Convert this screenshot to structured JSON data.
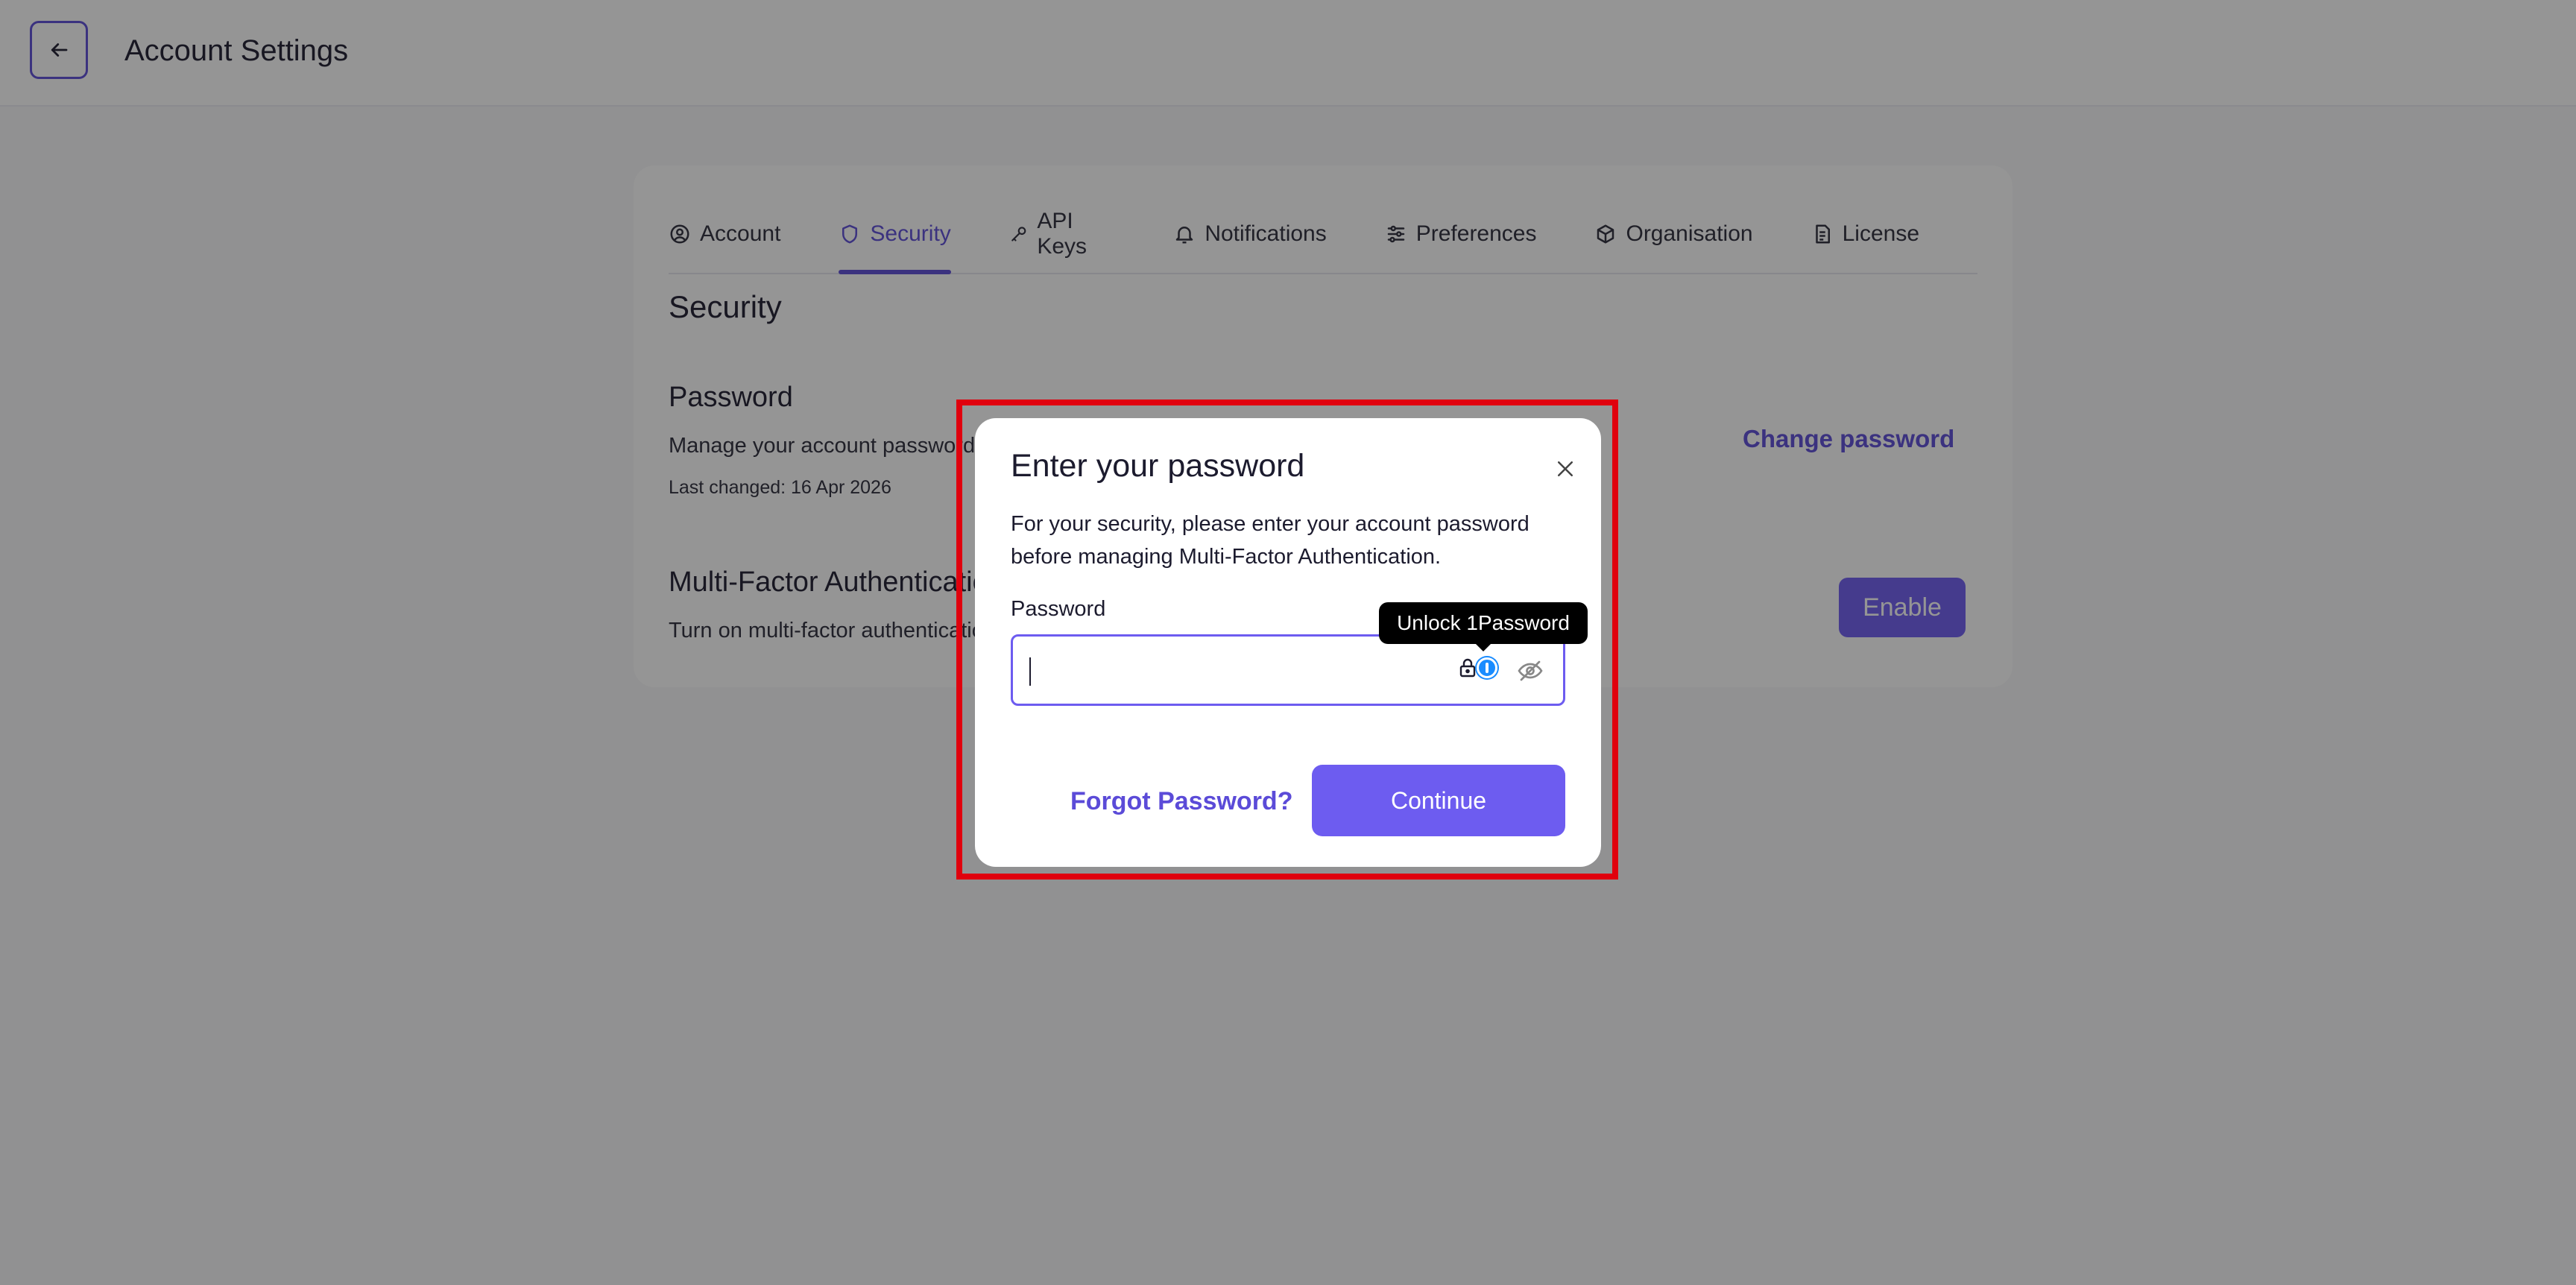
{
  "header": {
    "title": "Account Settings",
    "back_icon": "arrow-left-icon"
  },
  "tabs": [
    {
      "label": "Account",
      "icon": "user-circle-icon",
      "active": false
    },
    {
      "label": "Security",
      "icon": "shield-icon",
      "active": true
    },
    {
      "label": "API Keys",
      "icon": "key-icon",
      "active": false
    },
    {
      "label": "Notifications",
      "icon": "bell-icon",
      "active": false
    },
    {
      "label": "Preferences",
      "icon": "sliders-icon",
      "active": false
    },
    {
      "label": "Organisation",
      "icon": "cube-icon",
      "active": false
    },
    {
      "label": "License",
      "icon": "document-icon",
      "active": false
    }
  ],
  "security": {
    "heading": "Security",
    "password": {
      "title": "Password",
      "description": "Manage your account password",
      "last_changed": "Last changed: 16 Apr 2026",
      "action": "Change password"
    },
    "mfa": {
      "title": "Multi-Factor Authentication",
      "description": "Turn on multi-factor authentication",
      "action": "Enable"
    }
  },
  "modal": {
    "title": "Enter your password",
    "description": "For your security, please enter your account password before managing Multi-Factor Authentication.",
    "field_label": "Password",
    "field_value": "",
    "tooltip": "Unlock 1Password",
    "forgot_label": "Forgot Password?",
    "continue_label": "Continue"
  },
  "colors": {
    "accent": "#6d5cf0",
    "accent_text": "#5b4bd8",
    "highlight": "#e0000d",
    "password_manager_blue": "#1a8cff"
  }
}
